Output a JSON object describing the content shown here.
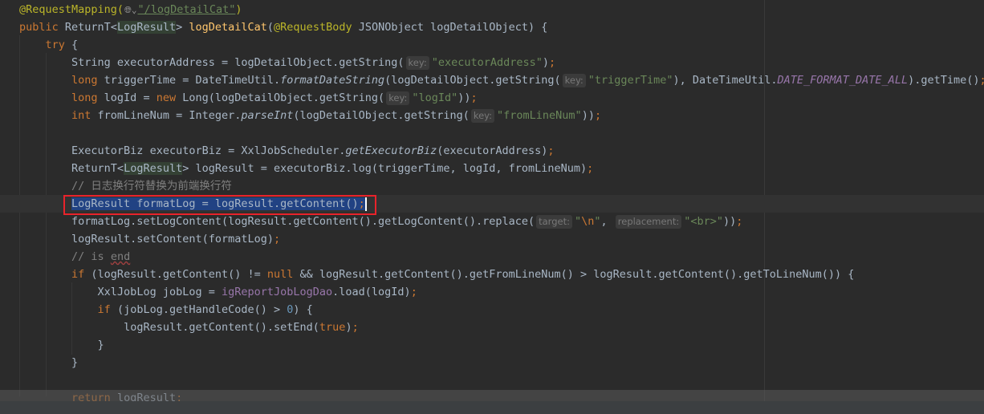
{
  "editor": {
    "language": "Java",
    "selected_line": 11,
    "lines": [
      {
        "indent": 0,
        "tokens": [
          [
            "ann",
            "@RequestMapping("
          ],
          [
            "globe",
            "🌐︎⌄"
          ],
          [
            "strlink",
            "\"/logDetailCat\""
          ],
          [
            "ann",
            ")"
          ]
        ]
      },
      {
        "indent": 0,
        "tokens": [
          [
            "kw",
            "public "
          ],
          [
            "plain",
            "ReturnT<"
          ],
          [
            "hl",
            "LogResult"
          ],
          [
            "plain",
            "> "
          ],
          [
            "fn",
            "logDetailCat"
          ],
          [
            "plain",
            "("
          ],
          [
            "ann",
            "@RequestBody"
          ],
          [
            "plain",
            " JSONObject logDetailObject) {"
          ]
        ]
      },
      {
        "indent": 4,
        "tokens": [
          [
            "kw",
            "try"
          ],
          [
            "plain",
            " {"
          ]
        ]
      },
      {
        "indent": 8,
        "tokens": [
          [
            "plain",
            "String executorAddress = logDetailObject.getString("
          ],
          [
            "hint",
            "key:"
          ],
          [
            "str",
            "\"executorAddress\""
          ],
          [
            "plain",
            ")"
          ],
          [
            "kw",
            ";"
          ]
        ]
      },
      {
        "indent": 8,
        "tokens": [
          [
            "kw",
            "long"
          ],
          [
            "plain",
            " triggerTime = DateTimeUtil."
          ],
          [
            "it",
            "formatDateString"
          ],
          [
            "plain",
            "(logDetailObject.getString("
          ],
          [
            "hint",
            "key:"
          ],
          [
            "str",
            "\"triggerTime\""
          ],
          [
            "plain",
            "), DateTimeUtil."
          ],
          [
            "field",
            "DATE_FORMAT_DATE_ALL"
          ],
          [
            "plain",
            ").getTime()"
          ],
          [
            "kw",
            ";"
          ]
        ]
      },
      {
        "indent": 8,
        "tokens": [
          [
            "kw",
            "long"
          ],
          [
            "plain",
            " logId = "
          ],
          [
            "kw",
            "new"
          ],
          [
            "plain",
            " Long(logDetailObject.getString("
          ],
          [
            "hint",
            "key:"
          ],
          [
            "str",
            "\"logId\""
          ],
          [
            "plain",
            "))"
          ],
          [
            "kw",
            ";"
          ]
        ]
      },
      {
        "indent": 8,
        "tokens": [
          [
            "kw",
            "int"
          ],
          [
            "plain",
            " fromLineNum = Integer."
          ],
          [
            "it",
            "parseInt"
          ],
          [
            "plain",
            "(logDetailObject.getString("
          ],
          [
            "hint",
            "key:"
          ],
          [
            "str",
            "\"fromLineNum\""
          ],
          [
            "plain",
            "))"
          ],
          [
            "kw",
            ";"
          ]
        ]
      },
      {
        "indent": 0,
        "tokens": []
      },
      {
        "indent": 8,
        "tokens": [
          [
            "plain",
            "ExecutorBiz executorBiz = XxlJobScheduler."
          ],
          [
            "it",
            "getExecutorBiz"
          ],
          [
            "plain",
            "(executorAddress)"
          ],
          [
            "kw",
            ";"
          ]
        ]
      },
      {
        "indent": 8,
        "tokens": [
          [
            "plain",
            "ReturnT<"
          ],
          [
            "hl",
            "LogResult"
          ],
          [
            "plain",
            "> logResult = executorBiz.log(triggerTime, logId, fromLineNum)"
          ],
          [
            "kw",
            ";"
          ]
        ]
      },
      {
        "indent": 8,
        "tokens": [
          [
            "comment",
            "// 日志换行符替换为前端换行符"
          ]
        ]
      },
      {
        "indent": 8,
        "tokens": [
          [
            "sel",
            "LogResult formatLog = logResult.getContent()"
          ],
          [
            "sel kw",
            ";"
          ],
          [
            "caret",
            ""
          ]
        ]
      },
      {
        "indent": 8,
        "tokens": [
          [
            "plain",
            "formatLog.setLogContent(logResult.getContent().getLogContent().replace("
          ],
          [
            "hint",
            "target:"
          ],
          [
            "str",
            "\""
          ],
          [
            "kw",
            "\\n"
          ],
          [
            "str",
            "\""
          ],
          [
            "plain",
            ", "
          ],
          [
            "hint",
            "replacement:"
          ],
          [
            "str",
            "\"<br>\""
          ],
          [
            "plain",
            "))"
          ],
          [
            "kw",
            ";"
          ]
        ]
      },
      {
        "indent": 8,
        "tokens": [
          [
            "plain",
            "logResult.setContent(formatLog)"
          ],
          [
            "kw",
            ";"
          ]
        ]
      },
      {
        "indent": 8,
        "tokens": [
          [
            "comment",
            "// is "
          ],
          [
            "typo",
            "end"
          ]
        ]
      },
      {
        "indent": 8,
        "tokens": [
          [
            "kw",
            "if"
          ],
          [
            "plain",
            " (logResult.getContent() != "
          ],
          [
            "kw",
            "null"
          ],
          [
            "plain",
            " && logResult.getContent().getFromLineNum() > logResult.getContent().getToLineNum()) {"
          ]
        ]
      },
      {
        "indent": 12,
        "tokens": [
          [
            "plain",
            "XxlJobLog jobLog = "
          ],
          [
            "inst",
            "igReportJobLogDao"
          ],
          [
            "plain",
            ".load(logId)"
          ],
          [
            "kw",
            ";"
          ]
        ]
      },
      {
        "indent": 12,
        "tokens": [
          [
            "kw",
            "if"
          ],
          [
            "plain",
            " (jobLog.getHandleCode() > "
          ],
          [
            "num",
            "0"
          ],
          [
            "plain",
            ") {"
          ]
        ]
      },
      {
        "indent": 16,
        "tokens": [
          [
            "plain",
            "logResult.getContent().setEnd("
          ],
          [
            "kw",
            "true"
          ],
          [
            "plain",
            ")"
          ],
          [
            "kw",
            ";"
          ]
        ]
      },
      {
        "indent": 12,
        "tokens": [
          [
            "plain",
            "}"
          ]
        ]
      },
      {
        "indent": 8,
        "tokens": [
          [
            "plain",
            "}"
          ]
        ]
      },
      {
        "indent": 0,
        "tokens": []
      },
      {
        "indent": 8,
        "tokens": [
          [
            "kw",
            "return"
          ],
          [
            "plain",
            " logResult"
          ],
          [
            "kw",
            ";"
          ]
        ]
      }
    ]
  },
  "colors": {
    "background": "#2b2b2b",
    "keyword": "#cc7832",
    "annotation": "#bbb529",
    "string": "#6a8759",
    "method_decl": "#ffc66d",
    "constant": "#9876aa",
    "comment": "#808080",
    "selection": "#214283",
    "highlight_box": "#e8232b"
  }
}
